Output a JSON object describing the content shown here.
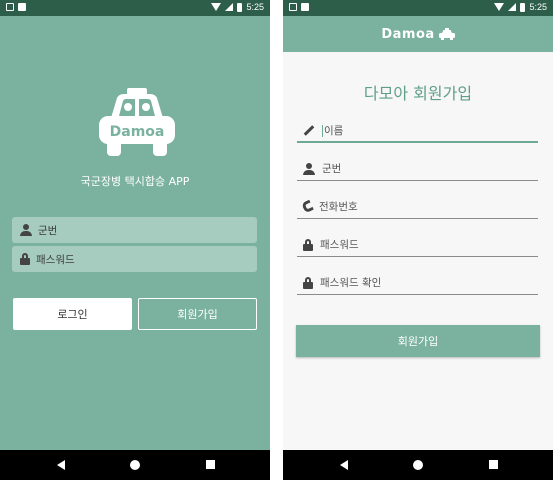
{
  "status_bar": {
    "time": "5:25"
  },
  "login": {
    "logo_text": "Damoa",
    "subtitle": "국군장병 택시합승 APP",
    "fields": [
      {
        "icon": "person-icon",
        "placeholder": "군번"
      },
      {
        "icon": "lock-icon",
        "placeholder": "패스워드"
      }
    ],
    "login_label": "로그인",
    "signup_label": "회원가입"
  },
  "signup": {
    "appbar_title": "Damoa",
    "form_title": "다모아 회원가입",
    "fields": [
      {
        "icon": "pencil-icon",
        "placeholder": "이름"
      },
      {
        "icon": "person-icon",
        "placeholder": "군번"
      },
      {
        "icon": "phone-icon",
        "placeholder": "전화번호"
      },
      {
        "icon": "lock-icon",
        "placeholder": "패스워드"
      },
      {
        "icon": "lock-icon",
        "placeholder": "패스워드 확인"
      }
    ],
    "submit_label": "회원가입"
  },
  "colors": {
    "primary": "#7ab29f",
    "status_bar": "#2d5e4a",
    "title_green": "#5f9e8a",
    "field_bg": "#a6cbbf"
  }
}
